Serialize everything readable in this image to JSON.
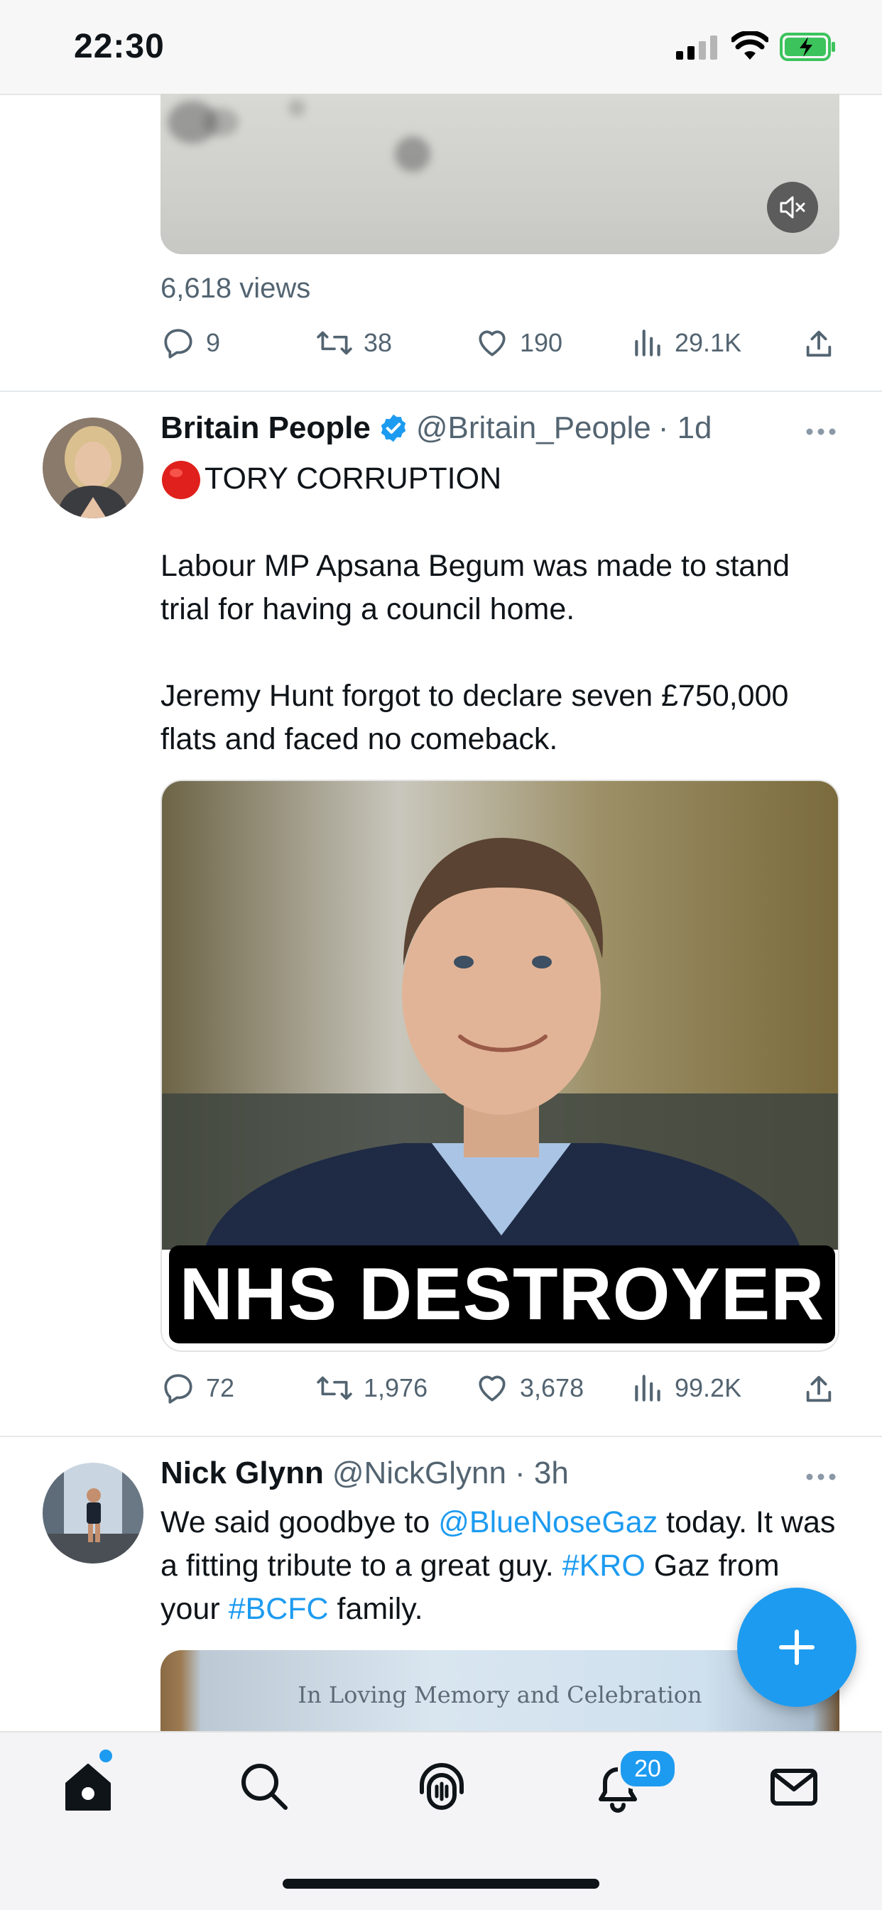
{
  "status_bar": {
    "time": "22:30"
  },
  "tweet1": {
    "views": "6,618 views",
    "replies": "9",
    "retweets": "38",
    "likes": "190",
    "view_count": "29.1K"
  },
  "tweet2": {
    "name": "Britain People",
    "handle": "@Britain_People",
    "time": "· 1d",
    "verified": true,
    "emoji": "🔴",
    "text": "TORY CORRUPTION\n\nLabour MP Apsana Begum was made to stand trial for having a council home.\n\nJeremy Hunt forgot to declare seven £750,000 flats and faced no comeback.",
    "image_caption": "NHS DESTROYER",
    "replies": "72",
    "retweets": "1,976",
    "likes": "3,678",
    "view_count": "99.2K"
  },
  "tweet3": {
    "name": "Nick Glynn",
    "handle": "@NickGlynn",
    "time": "· 3h",
    "text_part1": "We said goodbye to ",
    "mention": "@BlueNoseGaz",
    "text_part2": " today. It was a fitting tribute to a great guy. ",
    "hashtag1": "#KRO",
    "text_part3": " Gaz from your ",
    "hashtag2": "#BCFC",
    "text_part4": " family.",
    "image_text": "In Loving Memory and Celebration"
  },
  "tab_bar": {
    "items": [
      "home-icon",
      "search-icon",
      "spaces-icon",
      "notifications-icon",
      "messages-icon"
    ],
    "notification_badge": "20"
  },
  "colors": {
    "accent": "#1d9bf0",
    "text": "#0f1419",
    "secondary": "#536471"
  }
}
